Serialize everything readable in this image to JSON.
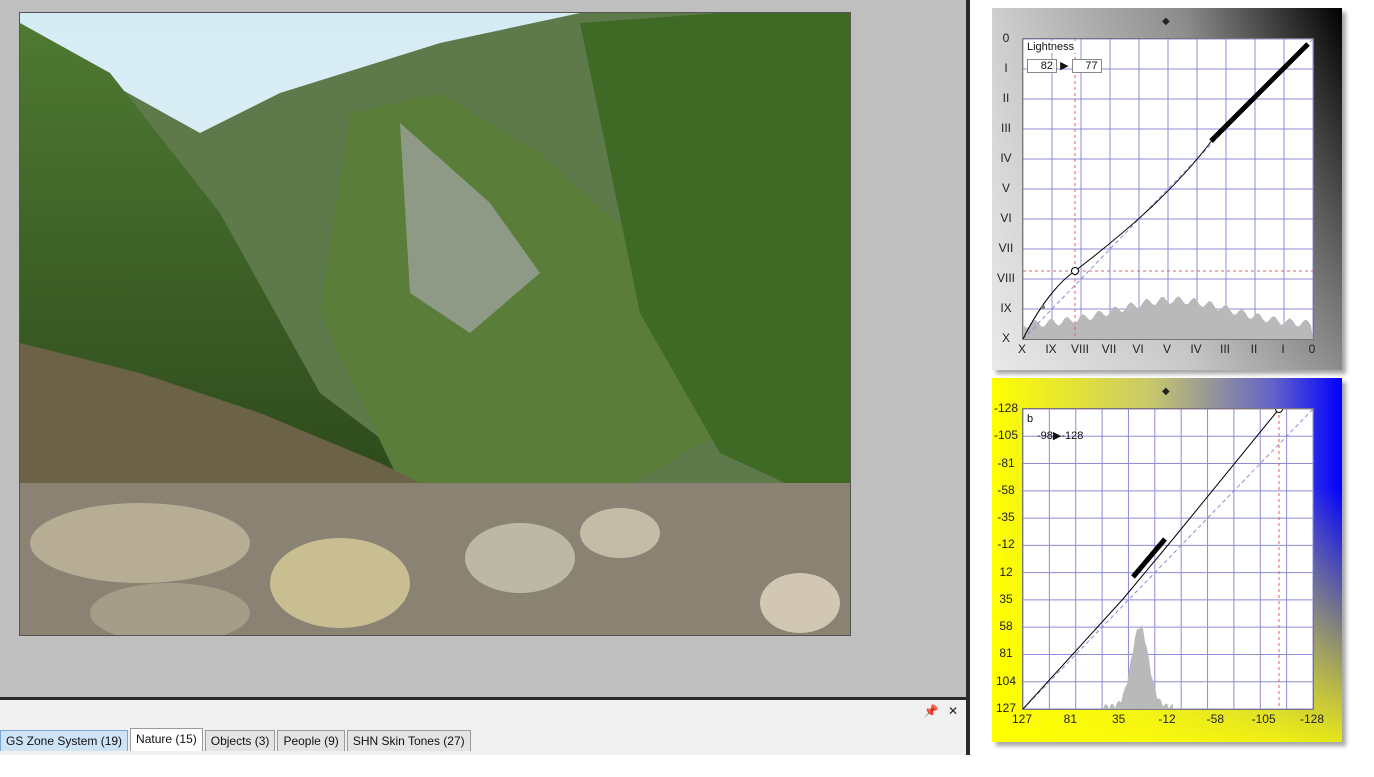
{
  "tabs": [
    {
      "label": "GS Zone System (19)"
    },
    {
      "label": "Nature (15)"
    },
    {
      "label": "Objects (3)"
    },
    {
      "label": "People (9)"
    },
    {
      "label": "SHN Skin Tones (27)"
    }
  ],
  "active_tab": "Nature (15)",
  "dock": {
    "pin_icon": "pin-icon",
    "close_icon": "close-icon"
  },
  "lightness_panel": {
    "channel_label": "Lightness",
    "input_value": "82",
    "output_value": "77",
    "arrow": "▶",
    "y_zones": [
      "0",
      "I",
      "II",
      "III",
      "IV",
      "V",
      "VI",
      "VII",
      "VIII",
      "IX",
      "X"
    ],
    "x_zones": [
      "X",
      "IX",
      "VIII",
      "VII",
      "VI",
      "V",
      "IV",
      "III",
      "II",
      "I",
      "0"
    ],
    "handle_icon": "resize-handle-icon"
  },
  "b_panel": {
    "channel_label": "b",
    "readout": "-98▶-128",
    "y_ticks": [
      "-128",
      "-105",
      "-81",
      "-58",
      "-35",
      "-12",
      "12",
      "35",
      "58",
      "81",
      "104",
      "127"
    ],
    "x_ticks": [
      "127",
      "81",
      "35",
      "-12",
      "-58",
      "-105",
      "-128"
    ],
    "handle_icon": "resize-handle-icon"
  },
  "colors": {
    "dock_border": "#2a2a2a",
    "grid_line": "#8c8cd8",
    "guide_red": "#e06060"
  }
}
